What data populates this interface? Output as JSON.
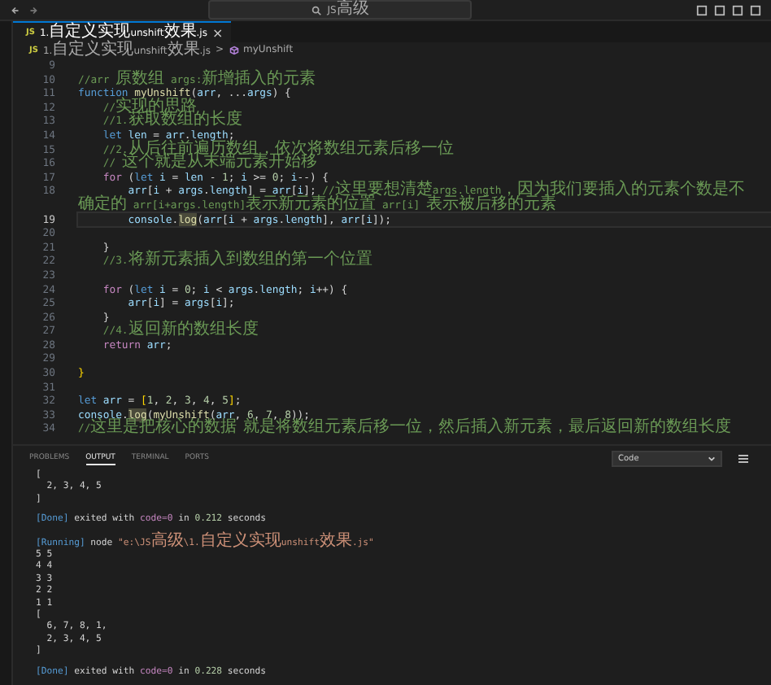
{
  "title_bar": {
    "search": "JS高级"
  },
  "tabs": [
    {
      "icon_text": "JS",
      "label": "1.自定义实现unshift效果.js",
      "close": "×",
      "selected": true
    }
  ],
  "breadcrumb": {
    "icon_text": "JS",
    "file": "1.自定义实现unshift效果.js",
    "separator": ">",
    "symbol": "myUnshift"
  },
  "editor": {
    "lines": [
      {
        "number": "9",
        "current": false
      },
      {
        "number": "10",
        "current": false,
        "tokens": [
          {
            "kind": "comment",
            "text": "//arr 原数组 args:新增插入的元素"
          }
        ]
      },
      {
        "number": "11",
        "current": false,
        "tokens": [
          {
            "kind": "keyword",
            "text": "function "
          },
          {
            "kind": "function",
            "text": "myUnshift"
          },
          {
            "kind": "plain",
            "text": "("
          },
          {
            "kind": "variable",
            "text": "arr"
          },
          {
            "kind": "plain",
            "text": ", ..."
          },
          {
            "kind": "variable",
            "text": "args"
          },
          {
            "kind": "plain",
            "text": ") {"
          }
        ]
      },
      {
        "number": "12",
        "current": false,
        "tokens": [
          {
            "kind": "comment",
            "text": "    //实现的思路"
          }
        ]
      },
      {
        "number": "13",
        "current": false,
        "tokens": [
          {
            "kind": "comment",
            "text": "    //1.获取数组的长度"
          }
        ]
      },
      {
        "number": "14",
        "current": false,
        "tokens": [
          {
            "kind": "keyword",
            "text": "    let "
          },
          {
            "kind": "variable",
            "text": "len"
          },
          {
            "kind": "plain",
            "text": " = "
          },
          {
            "kind": "variable",
            "text": "arr"
          },
          {
            "kind": "plain",
            "text": "."
          },
          {
            "kind": "variable",
            "text": "length"
          },
          {
            "kind": "plain",
            "text": ";"
          }
        ]
      },
      {
        "number": "15",
        "current": false,
        "tokens": [
          {
            "kind": "comment",
            "text": "    //2.从后往前遍历数组，依次将数组元素后移一位"
          }
        ]
      },
      {
        "number": "16",
        "current": false,
        "tokens": [
          {
            "kind": "comment",
            "text": "    // 这个就是从末端元素开始移"
          }
        ]
      },
      {
        "number": "17",
        "current": false,
        "tokens": [
          {
            "kind": "control",
            "text": "    for "
          },
          {
            "kind": "plain",
            "text": "("
          },
          {
            "kind": "keyword",
            "text": "let "
          },
          {
            "kind": "variable",
            "text": "i"
          },
          {
            "kind": "plain",
            "text": " = "
          },
          {
            "kind": "variable",
            "text": "len"
          },
          {
            "kind": "plain",
            "text": " - "
          },
          {
            "kind": "number",
            "text": "1"
          },
          {
            "kind": "plain",
            "text": "; "
          },
          {
            "kind": "variable",
            "text": "i"
          },
          {
            "kind": "plain",
            "text": " >= "
          },
          {
            "kind": "number",
            "text": "0"
          },
          {
            "kind": "plain",
            "text": "; "
          },
          {
            "kind": "variable",
            "text": "i"
          },
          {
            "kind": "plain",
            "text": "--) {"
          }
        ]
      },
      {
        "number": "18",
        "current": false,
        "tokens": [
          {
            "kind": "variable",
            "text": "        arr"
          },
          {
            "kind": "plain",
            "text": "["
          },
          {
            "kind": "variable",
            "text": "i"
          },
          {
            "kind": "plain",
            "text": " + "
          },
          {
            "kind": "variable",
            "text": "args"
          },
          {
            "kind": "plain",
            "text": "."
          },
          {
            "kind": "variable",
            "text": "length"
          },
          {
            "kind": "plain",
            "text": "] = "
          },
          {
            "kind": "variable",
            "text": "arr"
          },
          {
            "kind": "plain",
            "text": "["
          },
          {
            "kind": "variable",
            "text": "i"
          },
          {
            "kind": "plain",
            "text": "]; "
          },
          {
            "kind": "comment",
            "text": "//这里要想清楚args.length，因为我们要插入的元素个数是不确定的 arr[i+args.length]表示新元素的位置 arr[i] 表示被后移的元素"
          }
        ]
      },
      {
        "number": "19",
        "current": true,
        "tokens": [
          {
            "kind": "variable",
            "text": "        console"
          },
          {
            "kind": "plain",
            "text": "."
          },
          {
            "kind": "match",
            "text": "log"
          },
          {
            "kind": "plain",
            "text": "("
          },
          {
            "kind": "variable",
            "text": "arr"
          },
          {
            "kind": "plain",
            "text": "["
          },
          {
            "kind": "variable",
            "text": "i"
          },
          {
            "kind": "plain",
            "text": " + "
          },
          {
            "kind": "variable",
            "text": "args"
          },
          {
            "kind": "plain",
            "text": "."
          },
          {
            "kind": "variable",
            "text": "length"
          },
          {
            "kind": "plain",
            "text": "], "
          },
          {
            "kind": "variable",
            "text": "arr"
          },
          {
            "kind": "plain",
            "text": "["
          },
          {
            "kind": "variable",
            "text": "i"
          },
          {
            "kind": "plain",
            "text": "]);"
          }
        ]
      },
      {
        "number": "20",
        "current": false
      },
      {
        "number": "21",
        "current": false,
        "tokens": [
          {
            "kind": "plain",
            "text": "    }"
          }
        ]
      },
      {
        "number": "22",
        "current": false,
        "tokens": [
          {
            "kind": "comment",
            "text": "    //3.将新元素插入到数组的第一个位置"
          }
        ]
      },
      {
        "number": "23",
        "current": false
      },
      {
        "number": "24",
        "current": false,
        "tokens": [
          {
            "kind": "control",
            "text": "    for "
          },
          {
            "kind": "plain",
            "text": "("
          },
          {
            "kind": "keyword",
            "text": "let "
          },
          {
            "kind": "variable",
            "text": "i"
          },
          {
            "kind": "plain",
            "text": " = "
          },
          {
            "kind": "number",
            "text": "0"
          },
          {
            "kind": "plain",
            "text": "; "
          },
          {
            "kind": "variable",
            "text": "i"
          },
          {
            "kind": "plain",
            "text": " < "
          },
          {
            "kind": "variable",
            "text": "args"
          },
          {
            "kind": "plain",
            "text": "."
          },
          {
            "kind": "variable",
            "text": "length"
          },
          {
            "kind": "plain",
            "text": "; "
          },
          {
            "kind": "variable",
            "text": "i"
          },
          {
            "kind": "plain",
            "text": "++) {"
          }
        ]
      },
      {
        "number": "25",
        "current": false,
        "tokens": [
          {
            "kind": "variable",
            "text": "        arr"
          },
          {
            "kind": "plain",
            "text": "["
          },
          {
            "kind": "variable",
            "text": "i"
          },
          {
            "kind": "plain",
            "text": "] = "
          },
          {
            "kind": "variable",
            "text": "args"
          },
          {
            "kind": "plain",
            "text": "["
          },
          {
            "kind": "variable",
            "text": "i"
          },
          {
            "kind": "plain",
            "text": "];"
          }
        ]
      },
      {
        "number": "26",
        "current": false,
        "tokens": [
          {
            "kind": "plain",
            "text": "    }"
          }
        ]
      },
      {
        "number": "27",
        "current": false,
        "tokens": [
          {
            "kind": "comment",
            "text": "    //4.返回新的数组长度"
          }
        ]
      },
      {
        "number": "28",
        "current": false,
        "tokens": [
          {
            "kind": "control",
            "text": "    return "
          },
          {
            "kind": "variable",
            "text": "arr"
          },
          {
            "kind": "plain",
            "text": ";"
          }
        ]
      },
      {
        "number": "29",
        "current": false
      },
      {
        "number": "30",
        "current": false,
        "tokens": [
          {
            "kind": "bracket",
            "text": "}"
          }
        ]
      },
      {
        "number": "31",
        "current": false
      },
      {
        "number": "32",
        "current": false,
        "tokens": [
          {
            "kind": "keyword",
            "text": "let "
          },
          {
            "kind": "variable",
            "text": "arr"
          },
          {
            "kind": "plain",
            "text": " = "
          },
          {
            "kind": "bracket",
            "text": "["
          },
          {
            "kind": "number",
            "text": "1"
          },
          {
            "kind": "plain",
            "text": ", "
          },
          {
            "kind": "number",
            "text": "2"
          },
          {
            "kind": "plain",
            "text": ", "
          },
          {
            "kind": "number",
            "text": "3"
          },
          {
            "kind": "plain",
            "text": ", "
          },
          {
            "kind": "number",
            "text": "4"
          },
          {
            "kind": "plain",
            "text": ", "
          },
          {
            "kind": "number",
            "text": "5"
          },
          {
            "kind": "bracket",
            "text": "]"
          },
          {
            "kind": "plain",
            "text": ";"
          }
        ]
      },
      {
        "number": "33",
        "current": false,
        "tokens": [
          {
            "kind": "variable",
            "text": "console"
          },
          {
            "kind": "plain",
            "text": "."
          },
          {
            "kind": "match",
            "text": "log"
          },
          {
            "kind": "plain",
            "text": "("
          },
          {
            "kind": "function",
            "text": "myUnshift"
          },
          {
            "kind": "plain",
            "text": "("
          },
          {
            "kind": "variable",
            "text": "arr"
          },
          {
            "kind": "plain",
            "text": ", "
          },
          {
            "kind": "number",
            "text": "6"
          },
          {
            "kind": "plain",
            "text": ", "
          },
          {
            "kind": "number",
            "text": "7"
          },
          {
            "kind": "plain",
            "text": ", "
          },
          {
            "kind": "number",
            "text": "8"
          },
          {
            "kind": "plain",
            "text": "));"
          }
        ]
      },
      {
        "number": "34",
        "current": false,
        "tokens": [
          {
            "kind": "comment",
            "text": "//这里是把核心的数据 就是将数组元素后移一位，然后插入新元素，最后返回新的数组长度"
          }
        ]
      }
    ]
  },
  "panel": {
    "tabs": [
      {
        "label": "PROBLEMS",
        "selected": false
      },
      {
        "label": "OUTPUT",
        "selected": true
      },
      {
        "label": "TERMINAL",
        "selected": false
      },
      {
        "label": "PORTS",
        "selected": false
      }
    ],
    "channel": "Code",
    "output": [
      {
        "kind": "text",
        "segments": [
          {
            "kind": "plain",
            "text": "["
          }
        ]
      },
      {
        "kind": "text",
        "segments": [
          {
            "kind": "plain",
            "text": "  2, 3, 4, 5"
          }
        ]
      },
      {
        "kind": "text",
        "segments": [
          {
            "kind": "plain",
            "text": "]"
          }
        ]
      },
      {
        "kind": "blank"
      },
      {
        "kind": "text",
        "segments": [
          {
            "kind": "tag",
            "text": "[Done]"
          },
          {
            "kind": "plain",
            "text": " exited with "
          },
          {
            "kind": "code",
            "text": "code=0"
          },
          {
            "kind": "plain",
            "text": " in "
          },
          {
            "kind": "number",
            "text": "0.212"
          },
          {
            "kind": "plain",
            "text": " seconds"
          }
        ]
      },
      {
        "kind": "blank"
      },
      {
        "kind": "text",
        "segments": [
          {
            "kind": "tag",
            "text": "[Running]"
          },
          {
            "kind": "plain",
            "text": " node "
          },
          {
            "kind": "string",
            "text": "\"e:\\JS高级\\1.自定义实现unshift效果.js\""
          }
        ]
      },
      {
        "kind": "text",
        "segments": [
          {
            "kind": "plain",
            "text": "5 5"
          }
        ]
      },
      {
        "kind": "text",
        "segments": [
          {
            "kind": "plain",
            "text": "4 4"
          }
        ]
      },
      {
        "kind": "text",
        "segments": [
          {
            "kind": "plain",
            "text": "3 3"
          }
        ]
      },
      {
        "kind": "text",
        "segments": [
          {
            "kind": "plain",
            "text": "2 2"
          }
        ]
      },
      {
        "kind": "text",
        "segments": [
          {
            "kind": "plain",
            "text": "1 1"
          }
        ]
      },
      {
        "kind": "text",
        "segments": [
          {
            "kind": "plain",
            "text": "["
          }
        ]
      },
      {
        "kind": "text",
        "segments": [
          {
            "kind": "plain",
            "text": "  6, 7, 8, 1,"
          }
        ]
      },
      {
        "kind": "text",
        "segments": [
          {
            "kind": "plain",
            "text": "  2, 3, 4, 5"
          }
        ]
      },
      {
        "kind": "text",
        "segments": [
          {
            "kind": "plain",
            "text": "]"
          }
        ]
      },
      {
        "kind": "blank"
      },
      {
        "kind": "text",
        "segments": [
          {
            "kind": "tag",
            "text": "[Done]"
          },
          {
            "kind": "plain",
            "text": " exited with "
          },
          {
            "kind": "code",
            "text": "code=0"
          },
          {
            "kind": "plain",
            "text": " in "
          },
          {
            "kind": "number",
            "text": "0.228"
          },
          {
            "kind": "plain",
            "text": " seconds"
          }
        ]
      }
    ]
  }
}
